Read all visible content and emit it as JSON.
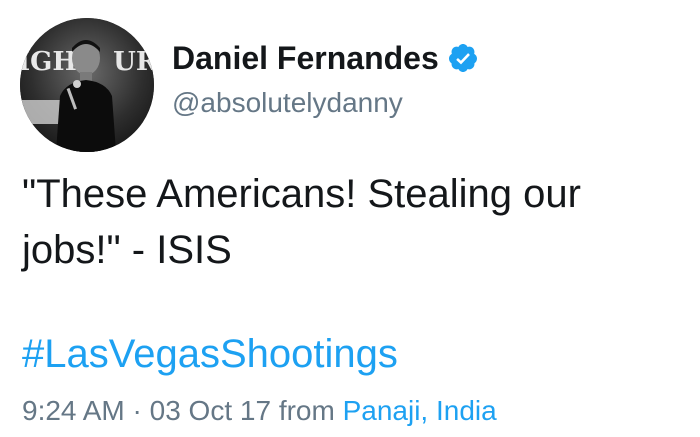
{
  "tweet": {
    "display_name": "Daniel Fernandes",
    "handle": "@absolutelydanny",
    "verified": true,
    "verified_icon": "verified-badge-icon",
    "avatar_banner_text": "IGH    URI",
    "text_line_1": "\"These Americans! Stealing our",
    "text_line_2": "jobs!\" - ISIS",
    "hashtag": "#LasVegasShootings",
    "time": "9:24 AM",
    "separator": "·",
    "date": "03 Oct 17",
    "from_label": "from",
    "location": "Panaji, India"
  },
  "colors": {
    "text": "#14171a",
    "secondary": "#657786",
    "link": "#1da1f2",
    "verified": "#1da1f2"
  }
}
